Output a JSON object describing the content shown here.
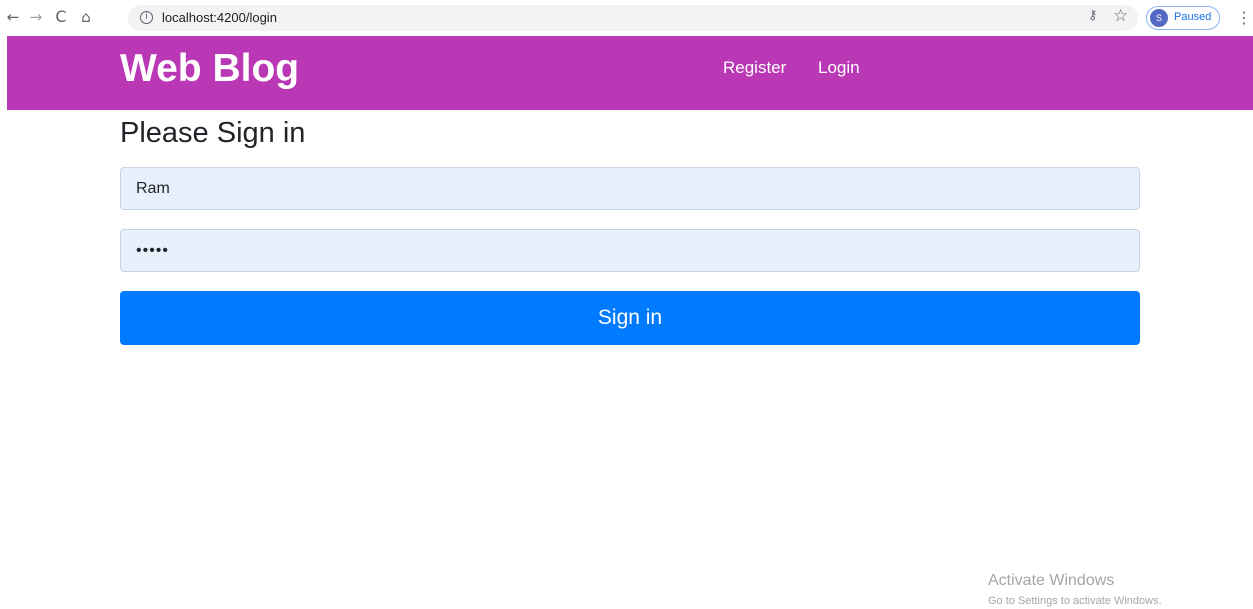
{
  "browser": {
    "back_icon": "←",
    "forward_icon": "→",
    "reload_icon": "C",
    "home_icon": "⌂",
    "info_icon": "i",
    "url": "localhost:4200/login",
    "key_icon": "⚷",
    "star_icon": "☆",
    "profile_initial": "S",
    "profile_status": "Paused",
    "menu_icon": "⋮"
  },
  "navbar": {
    "brand": "Web Blog",
    "links": [
      {
        "label": "Register"
      },
      {
        "label": "Login"
      }
    ],
    "color": "#ba38b5"
  },
  "form": {
    "heading": "Please Sign in",
    "username_value": "Ram",
    "password_value": "•••••",
    "submit_label": "Sign in",
    "button_color": "#007bff"
  },
  "watermark": {
    "title": "Activate Windows",
    "subtitle": "Go to Settings to activate Windows."
  }
}
